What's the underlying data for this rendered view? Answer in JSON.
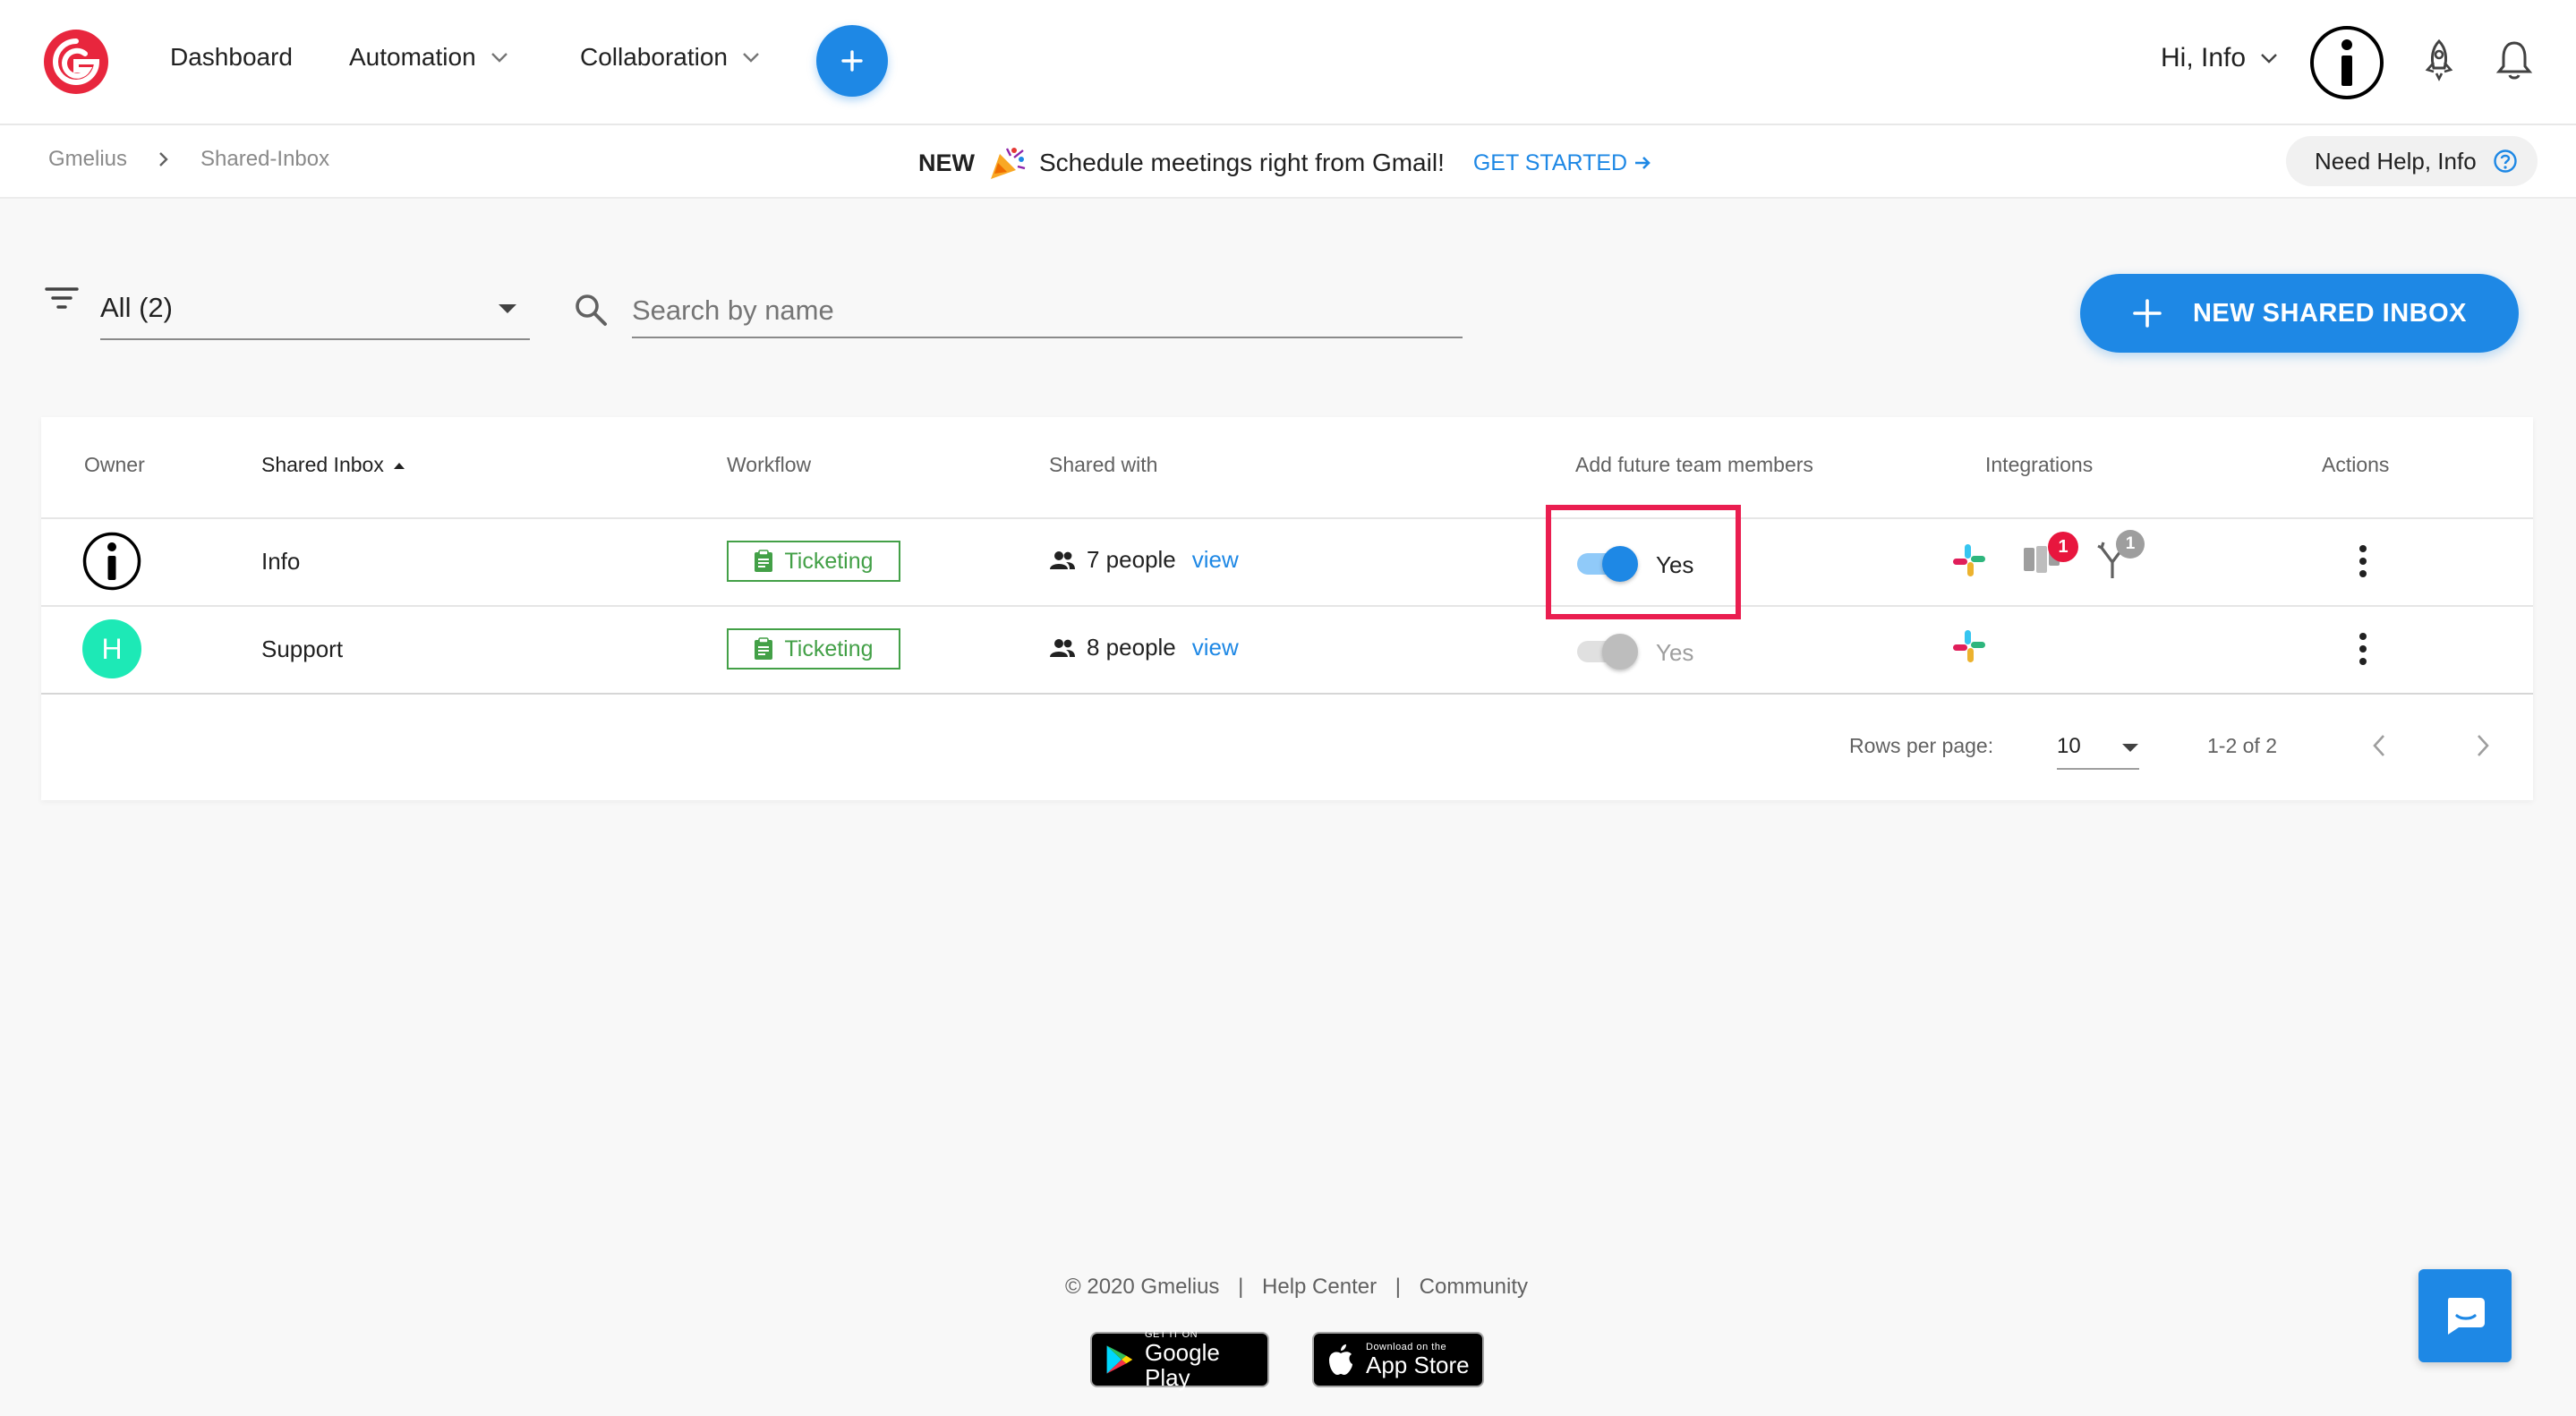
{
  "nav": {
    "dashboard": "Dashboard",
    "automation": "Automation",
    "collaboration": "Collaboration",
    "greeting": "Hi, Info"
  },
  "subbar": {
    "breadcrumb_root": "Gmelius",
    "breadcrumb_current": "Shared-Inbox",
    "promo_new": "NEW",
    "promo_message": "Schedule meetings right from Gmail!",
    "promo_cta": "GET STARTED",
    "help": "Need Help, Info"
  },
  "toolbar": {
    "filter_value": "All (2)",
    "search_placeholder": "Search by name",
    "new_inbox_label": "NEW SHARED INBOX"
  },
  "table": {
    "headers": {
      "owner": "Owner",
      "shared_inbox": "Shared Inbox",
      "workflow": "Workflow",
      "shared_with": "Shared with",
      "future_members": "Add future team members",
      "integrations": "Integrations",
      "actions": "Actions"
    },
    "rows": [
      {
        "owner_initial": "i",
        "name": "Info",
        "workflow": "Ticketing",
        "shared_with": "7 people",
        "view": "view",
        "future_members": "Yes",
        "future_members_on": true,
        "badge_trello": "1",
        "badge_branch": "1"
      },
      {
        "owner_initial": "H",
        "name": "Support",
        "workflow": "Ticketing",
        "shared_with": "8 people",
        "view": "view",
        "future_members": "Yes",
        "future_members_on": false
      }
    ],
    "pagination": {
      "rows_per_page_label": "Rows per page:",
      "rows_per_page_value": "10",
      "range": "1-2 of 2"
    }
  },
  "footer": {
    "copyright": "© 2020 Gmelius",
    "help_center": "Help Center",
    "community": "Community",
    "google_small": "GET IT ON",
    "google_big": "Google Play",
    "apple_small": "Download on the",
    "apple_big": "App Store"
  },
  "colors": {
    "accent": "#1e88e5",
    "brand_red": "#e8263d",
    "success_green": "#43a047",
    "highlight": "#ea1e50",
    "avatar_teal": "#1de9b6"
  }
}
